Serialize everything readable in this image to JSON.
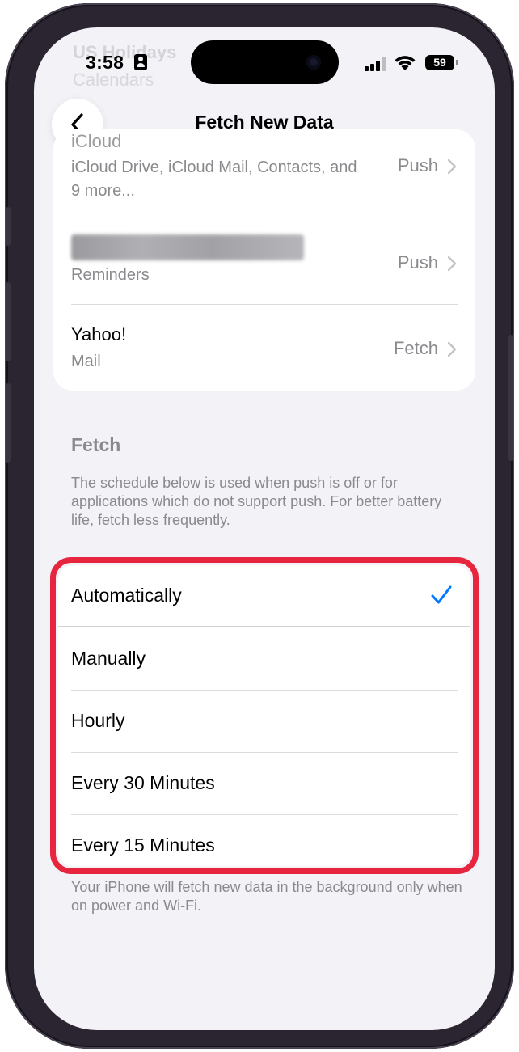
{
  "status_bar": {
    "time": "3:58",
    "battery": "59",
    "background_ghost_title": "US Holidays",
    "background_ghost_subtitle": "Calendars"
  },
  "nav": {
    "title": "Fetch New Data",
    "back_icon": "chevron-left-icon"
  },
  "accounts": [
    {
      "title": "iCloud",
      "subtitle": "iCloud Drive, iCloud Mail, Contacts, and 9 more...",
      "value": "Push"
    },
    {
      "title": "",
      "subtitle": "Reminders",
      "value": "Push"
    },
    {
      "title": "Yahoo!",
      "subtitle": "Mail",
      "value": "Fetch"
    }
  ],
  "fetch_section": {
    "header": "Fetch",
    "description": "The schedule below is used when push is off or for applications which do not support push. For better battery life, fetch less frequently.",
    "options": [
      {
        "label": "Automatically",
        "selected": true
      },
      {
        "label": "Manually",
        "selected": false
      },
      {
        "label": "Hourly",
        "selected": false
      },
      {
        "label": "Every 30 Minutes",
        "selected": false
      },
      {
        "label": "Every 15 Minutes",
        "selected": false
      }
    ],
    "footer": "Your iPhone will fetch new data in the background only when on power and Wi-Fi."
  },
  "colors": {
    "accent": "#007aff",
    "highlight": "#e8253f",
    "secondary_text": "#8a8a8e",
    "background": "#f2f2f7"
  }
}
